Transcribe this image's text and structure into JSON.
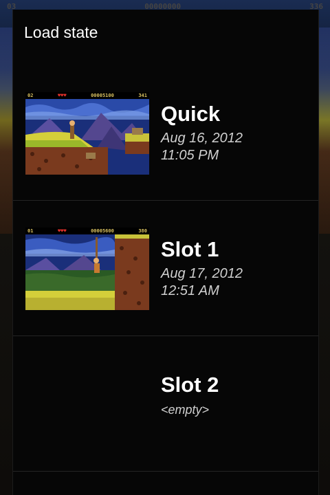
{
  "dialog": {
    "title": "Load state"
  },
  "backdrop_hud": {
    "left": "03",
    "center": "00000000",
    "right": "336"
  },
  "slots": [
    {
      "name": "Quick",
      "date": "Aug 16, 2012",
      "time": "11:05 PM",
      "empty": false,
      "hud": {
        "left": "02",
        "hearts": "♥♥♥",
        "score": "00005100",
        "right": "341"
      }
    },
    {
      "name": "Slot 1",
      "date": "Aug 17, 2012",
      "time": "12:51 AM",
      "empty": false,
      "hud": {
        "left": "01",
        "hearts": "♥♥♥",
        "score": "00005600",
        "right": "380"
      }
    },
    {
      "name": "Slot 2",
      "empty_label": "<empty>",
      "empty": true
    }
  ],
  "colors": {
    "dialog_bg": "#060606",
    "text_primary": "#ffffff",
    "text_secondary": "#d0d0d0",
    "divider": "#242424"
  }
}
